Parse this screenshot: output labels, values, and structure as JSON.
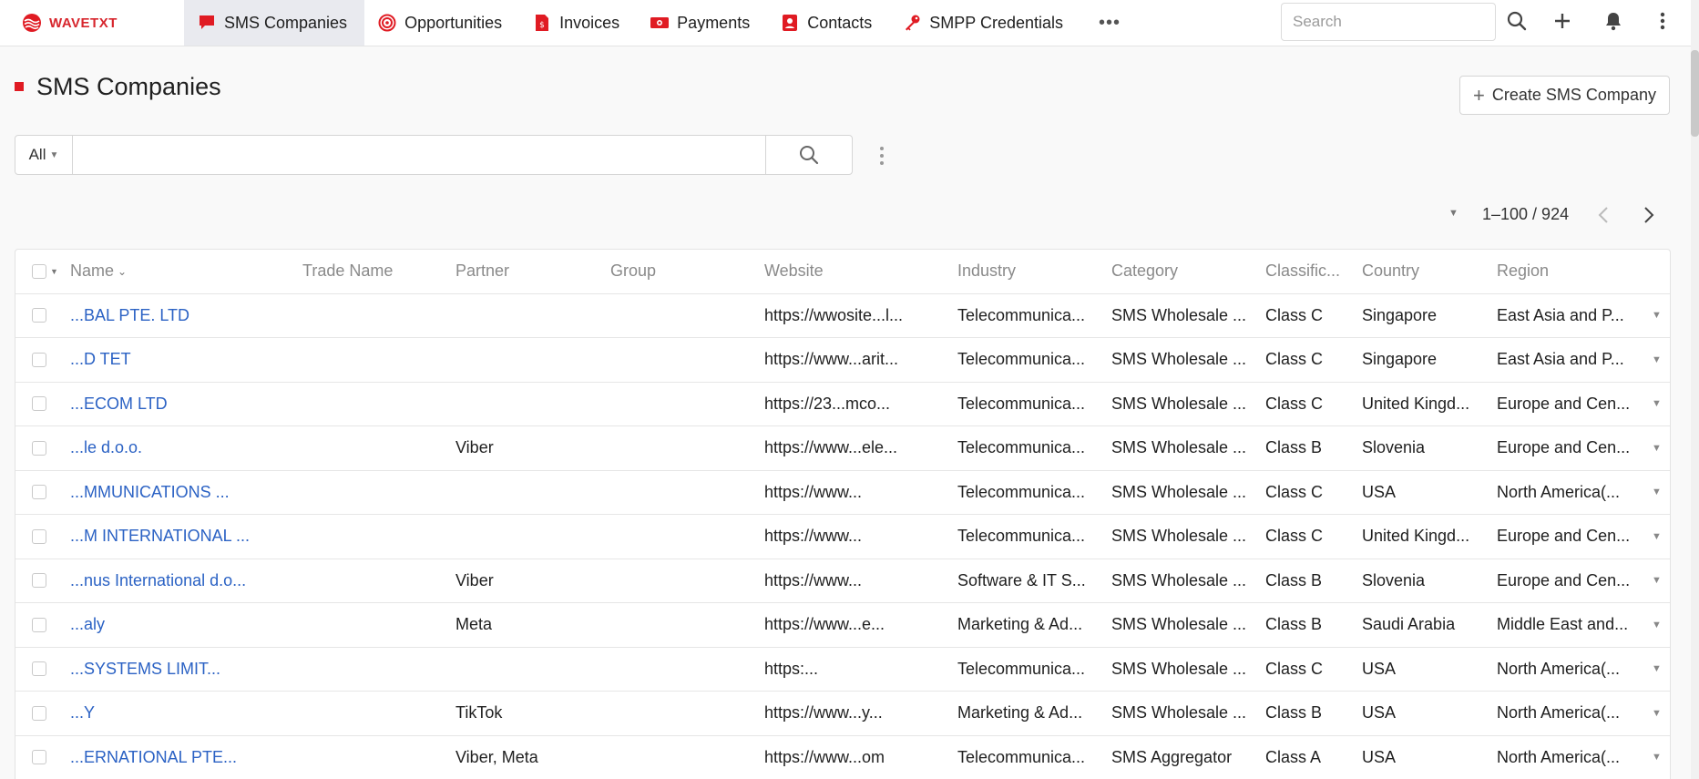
{
  "brand": {
    "name": "WAVETXT"
  },
  "nav": {
    "items": [
      {
        "label": "SMS Companies",
        "icon": "chat-bubble-icon",
        "active": true
      },
      {
        "label": "Opportunities",
        "icon": "target-icon",
        "active": false
      },
      {
        "label": "Invoices",
        "icon": "invoice-icon",
        "active": false
      },
      {
        "label": "Payments",
        "icon": "money-icon",
        "active": false
      },
      {
        "label": "Contacts",
        "icon": "contact-card-icon",
        "active": false
      },
      {
        "label": "SMPP Credentials",
        "icon": "key-icon",
        "active": false
      }
    ],
    "more_label": "•••"
  },
  "topbar": {
    "search_placeholder": "Search"
  },
  "page": {
    "title": "SMS Companies",
    "create_label": "Create SMS Company"
  },
  "filter": {
    "scope": "All",
    "query": ""
  },
  "pager": {
    "range": "1–100 / 924"
  },
  "table": {
    "columns": [
      "Name",
      "Trade Name",
      "Partner",
      "Group",
      "Website",
      "Industry",
      "Category",
      "Classific...",
      "Country",
      "Region"
    ],
    "rows": [
      {
        "name": "...BAL PTE. LTD",
        "trade": "",
        "partner": "",
        "group": "",
        "website": "https://wwosite...l...",
        "industry": "Telecommunica...",
        "category": "SMS Wholesale ...",
        "class": "Class C",
        "country": "Singapore",
        "region": "East Asia and P..."
      },
      {
        "name": "...D TET",
        "trade": "",
        "partner": "",
        "group": "",
        "website": "https://www...arit...",
        "industry": "Telecommunica...",
        "category": "SMS Wholesale ...",
        "class": "Class C",
        "country": "Singapore",
        "region": "East Asia and P..."
      },
      {
        "name": "...ECOM LTD",
        "trade": "",
        "partner": "",
        "group": "",
        "website": "https://23...mco...",
        "industry": "Telecommunica...",
        "category": "SMS Wholesale ...",
        "class": "Class C",
        "country": "United Kingd...",
        "region": "Europe and Cen..."
      },
      {
        "name": "...le d.o.o.",
        "trade": "",
        "partner": "Viber",
        "group": "",
        "website": "https://www...ele...",
        "industry": "Telecommunica...",
        "category": "SMS Wholesale ...",
        "class": "Class B",
        "country": "Slovenia",
        "region": "Europe and Cen..."
      },
      {
        "name": "...MMUNICATIONS ...",
        "trade": "",
        "partner": "",
        "group": "",
        "website": "https://www...",
        "industry": "Telecommunica...",
        "category": "SMS Wholesale ...",
        "class": "Class C",
        "country": "USA",
        "region": "North America(..."
      },
      {
        "name": "...M INTERNATIONAL ...",
        "trade": "",
        "partner": "",
        "group": "",
        "website": "https://www...",
        "industry": "Telecommunica...",
        "category": "SMS Wholesale ...",
        "class": "Class C",
        "country": "United Kingd...",
        "region": "Europe and Cen..."
      },
      {
        "name": "...nus International d.o...",
        "trade": "",
        "partner": "Viber",
        "group": "",
        "website": "https://www...",
        "industry": "Software & IT S...",
        "category": "SMS Wholesale ...",
        "class": "Class B",
        "country": "Slovenia",
        "region": "Europe and Cen..."
      },
      {
        "name": "...aly",
        "trade": "",
        "partner": "Meta",
        "group": "",
        "website": "https://www...e...",
        "industry": "Marketing & Ad...",
        "category": "SMS Wholesale ...",
        "class": "Class B",
        "country": "Saudi Arabia",
        "region": "Middle East and..."
      },
      {
        "name": "...SYSTEMS LIMIT...",
        "trade": "",
        "partner": "",
        "group": "",
        "website": "https:...",
        "industry": "Telecommunica...",
        "category": "SMS Wholesale ...",
        "class": "Class C",
        "country": "USA",
        "region": "North America(..."
      },
      {
        "name": "...Y",
        "trade": "",
        "partner": "TikTok",
        "group": "",
        "website": "https://www...y...",
        "industry": "Marketing & Ad...",
        "category": "SMS Wholesale ...",
        "class": "Class B",
        "country": "USA",
        "region": "North America(..."
      },
      {
        "name": "...ERNATIONAL PTE...",
        "trade": "",
        "partner": "Viber, Meta",
        "group": "",
        "website": "https://www...om",
        "industry": "Telecommunica...",
        "category": "SMS Aggregator",
        "class": "Class A",
        "country": "USA",
        "region": "North America(..."
      }
    ]
  },
  "colors": {
    "brand_red": "#e01b23",
    "link_blue": "#2b62c4",
    "active_nav_bg": "#e9eaef"
  }
}
